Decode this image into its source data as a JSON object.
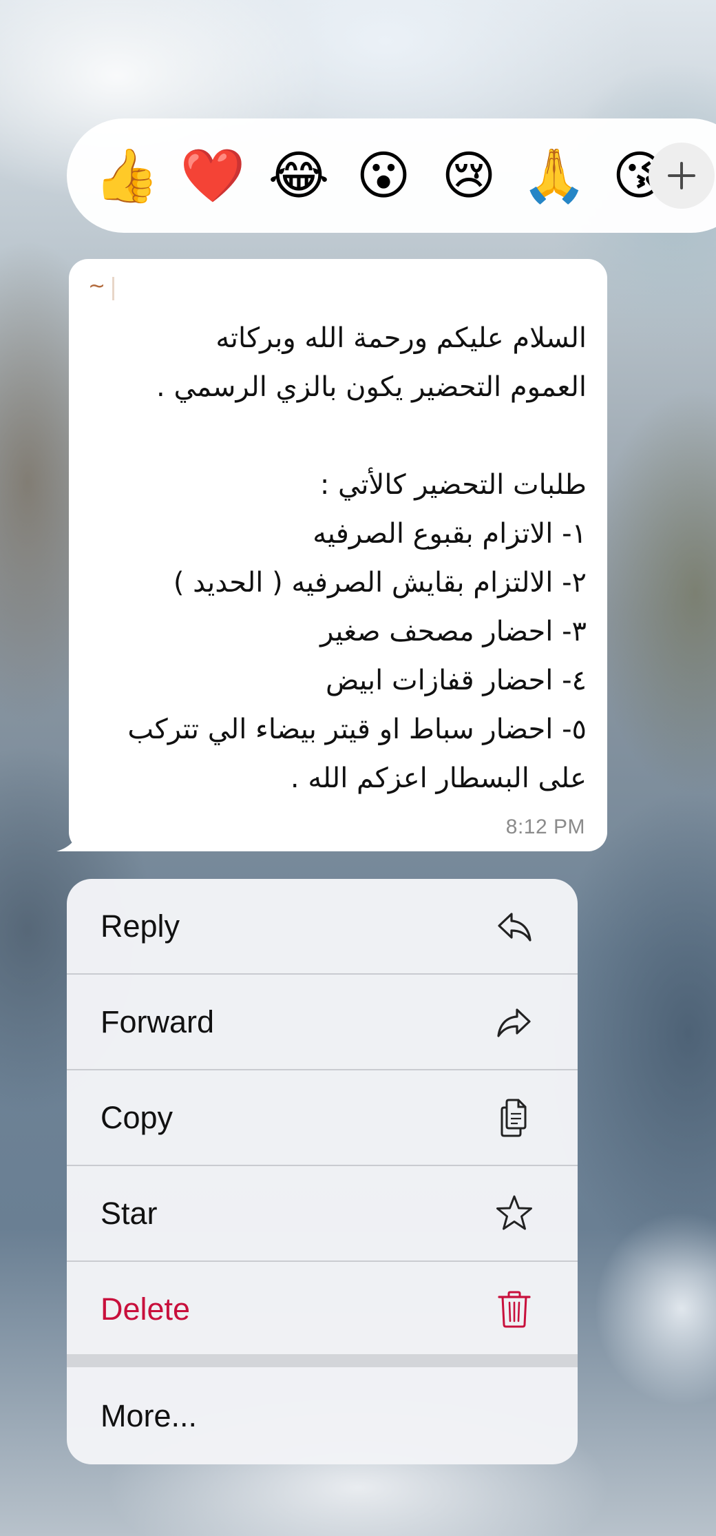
{
  "reaction_bar": {
    "emojis": [
      {
        "name": "thumbs-up-icon",
        "char": "👍"
      },
      {
        "name": "red-heart-icon",
        "char": "❤️"
      },
      {
        "name": "tears-of-joy-icon",
        "char": "😂"
      },
      {
        "name": "surprised-face-icon",
        "char": "😮"
      },
      {
        "name": "crying-face-icon",
        "char": "😢"
      },
      {
        "name": "folded-hands-icon",
        "char": "🙏"
      },
      {
        "name": "kissing-face-icon",
        "char": "😘"
      }
    ],
    "more_icon": "plus-icon"
  },
  "message": {
    "sender": "~",
    "text": "السلام عليكم ورحمة الله وبركاته\nالعموم التحضير يكون بالزي الرسمي .\n\nطلبات التحضير كالأتي :\n١- الاتزام بقبوع الصرفيه\n٢- الالتزام بقايش الصرفيه ( الحديد )\n٣- احضار مصحف صغير\n٤- احضار قفازات ابيض\n٥- احضار سباط او قيتر بيضاء الي تتركب على البسطار اعزكم الله .",
    "time": "8:12 PM"
  },
  "menu": {
    "reply": "Reply",
    "forward": "Forward",
    "copy": "Copy",
    "star": "Star",
    "delete": "Delete",
    "more": "More..."
  },
  "colors": {
    "delete": "#c8103c",
    "sender": "#b26a3c",
    "time": "#8b8b8b"
  }
}
